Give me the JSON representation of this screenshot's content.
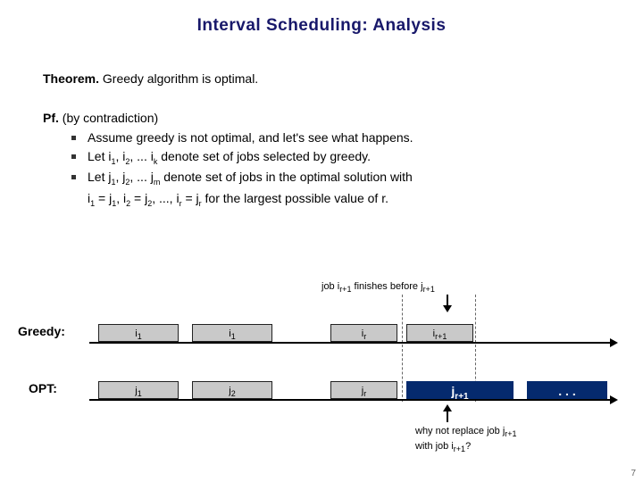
{
  "title": "Interval Scheduling:  Analysis",
  "theorem": {
    "lead": "Theorem.",
    "text": " Greedy algorithm is optimal."
  },
  "pf": {
    "lead": "Pf.",
    "text": " (by contradiction)"
  },
  "bullets": {
    "b1": "Assume greedy is not optimal, and let's see what happens.",
    "b2a": "Let i",
    "b2b": ", i",
    "b2c": ", ... i",
    "b2d": " denote set of jobs selected by greedy.",
    "b3a": "Let j",
    "b3b": ", j",
    "b3c": ", ... j",
    "b3d": " denote set of jobs in the optimal solution with",
    "b3e": "i",
    "b3f": " = j",
    "b3g": ", i",
    "b3h": " = j",
    "b3i": ", ..., i",
    "b3j": " = j",
    "b3k": " for the largest possible value of r."
  },
  "subs": {
    "s1": "1",
    "s2": "2",
    "sk": "k",
    "sm": "m",
    "sr": "r",
    "srp1": "r+1"
  },
  "cap_top_a": "job i",
  "cap_top_b": " finishes before j",
  "labels": {
    "greedy": "Greedy:",
    "opt": "OPT:"
  },
  "greedy_boxes": {
    "a": "i",
    "b": "i",
    "c": "i",
    "d": "i"
  },
  "opt_boxes": {
    "a": "j",
    "b": "j",
    "c": "j",
    "d": "j",
    "dots": ". . ."
  },
  "cap_bot_a": "why not replace job j",
  "cap_bot_b": "with job i",
  "cap_bot_c": "?",
  "page": "7"
}
